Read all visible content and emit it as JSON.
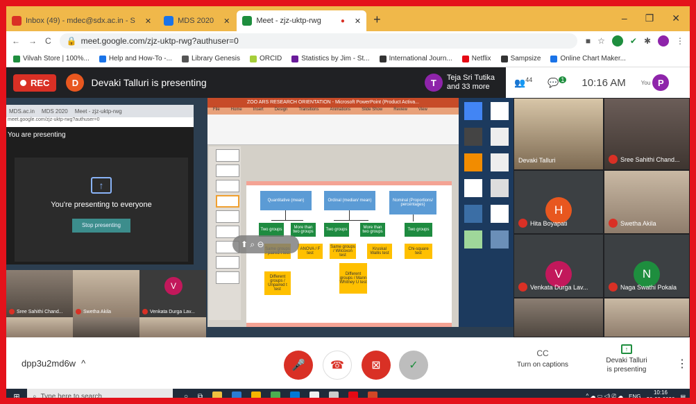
{
  "browser": {
    "tabs": [
      {
        "label": "Inbox (49) - mdec@sdx.ac.in - S",
        "icon": "gmail-icon",
        "color": "#d93025"
      },
      {
        "label": "MDS 2020",
        "icon": "classroom-icon",
        "color": "#1a73e8"
      },
      {
        "label": "Meet - zjz-uktp-rwg",
        "icon": "meet-icon",
        "color": "#1e8e3e"
      }
    ],
    "url": "meet.google.com/zjz-uktp-rwg?authuser=0",
    "bookmarks": [
      "Vilvah Store | 100%...",
      "Help and How-To -...",
      "Library Genesis",
      "ORCID",
      "Statistics by Jim - St...",
      "International Journ...",
      "Netflix",
      "Sampsize",
      "Online Chart Maker..."
    ]
  },
  "meet_header": {
    "rec_label": "REC",
    "presenter_initial": "D",
    "presenting_text": "Devaki Talluri is presenting",
    "others_initial": "T",
    "others_text_1": "Teja Sri Tutika",
    "others_text_2": "and 33 more",
    "people_count": "44",
    "chat_count": "1",
    "time": "10:16 AM",
    "you_label": "You",
    "you_initial": "P"
  },
  "shared_screen": {
    "left_tabs": [
      "MDS.ac.in",
      "MDS 2020",
      "Meet - zjz-uktp-rwg"
    ],
    "left_url": "meet.google.com/zjz-uktp-rwg?authuser=0",
    "you_are_presenting": "You are presenting",
    "presenting_to_everyone": "You're presenting to everyone",
    "stop_presenting": "Stop presenting",
    "ppt_title": "ZOO ARS RESEARCH ORIENTATION - Microsoft PowerPoint (Product Activa...",
    "ppt_tabs": [
      "File",
      "Home",
      "Insert",
      "Design",
      "Transitions",
      "Animations",
      "Slide Show",
      "Review",
      "View"
    ],
    "diagram": {
      "top": [
        "Quantitative (mean)",
        "Ordinal (median/ mean)",
        "Nominal (Proportions/ percentages)"
      ],
      "green": [
        "Two groups",
        "More than two groups",
        "Two groups",
        "More than two groups",
        "Two groups",
        "More than two groups"
      ],
      "yellow": [
        "Same groups / paired t test",
        "ANOVA / F test",
        "Same groups / Wilcoxon test",
        "Kruskal Wallis test",
        "Chi-square test",
        "Different groups / Unpaired t test",
        "Different groups / Mann Whitney U test"
      ]
    },
    "thumbnails": [
      "Sree Sahithi Chand...",
      "Swetha Akila",
      "Venkata Durga Lav..."
    ],
    "thumb_initial": "V"
  },
  "participants": [
    {
      "name": "Devaki Talluri",
      "type": "video",
      "muted": false
    },
    {
      "name": "Sree Sahithi Chand...",
      "type": "video",
      "muted": true
    },
    {
      "name": "Hita Boyapati",
      "type": "avatar",
      "initial": "H",
      "color": "#e8571f",
      "muted": true
    },
    {
      "name": "Swetha Akila",
      "type": "video",
      "muted": true
    },
    {
      "name": "Venkata Durga Lav...",
      "type": "avatar",
      "initial": "V",
      "color": "#c2185b",
      "muted": true
    },
    {
      "name": "Naga Swathi Pokala",
      "type": "avatar",
      "initial": "N",
      "color": "#1e8e3e",
      "muted": true
    }
  ],
  "bottom_bar": {
    "meeting_code": "dpp3u2md6w",
    "captions_label": "Turn on captions",
    "presenting_line1": "Devaki Talluri",
    "presenting_line2": "is presenting"
  },
  "taskbar": {
    "search_placeholder": "Type here to search",
    "lang": "ENG",
    "time": "10:16",
    "date": "20-08-2020"
  }
}
